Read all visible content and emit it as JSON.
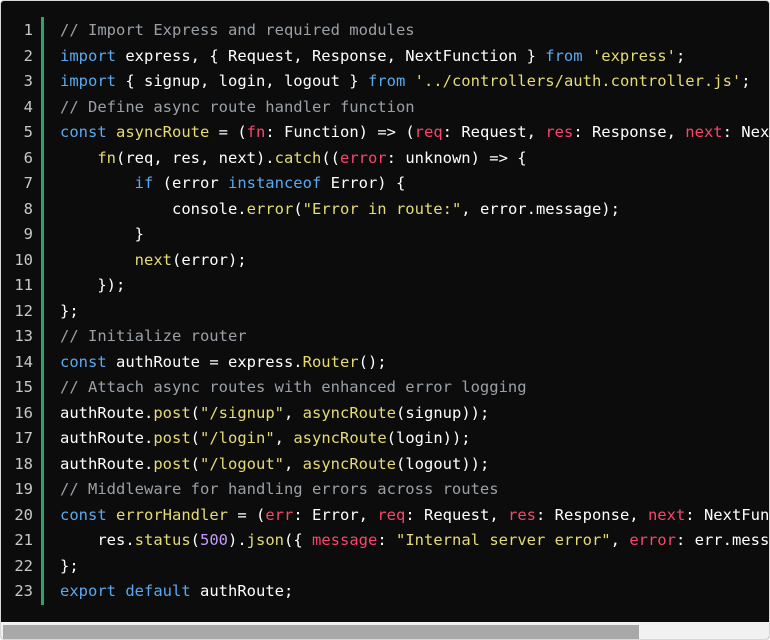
{
  "editor": {
    "accent_color": "#2fa36a",
    "background_color": "#0c0c0c",
    "lines": [
      {
        "n": "1",
        "tokens": [
          {
            "t": "comment",
            "v": "// Import Express and required modules"
          }
        ]
      },
      {
        "n": "2",
        "tokens": [
          {
            "t": "kw",
            "v": "import"
          },
          {
            "t": "plain",
            "v": " express, { Request, Response, NextFunction } "
          },
          {
            "t": "kw",
            "v": "from"
          },
          {
            "t": "plain",
            "v": " "
          },
          {
            "t": "str",
            "v": "'express'"
          },
          {
            "t": "plain",
            "v": ";"
          }
        ]
      },
      {
        "n": "3",
        "tokens": [
          {
            "t": "kw",
            "v": "import"
          },
          {
            "t": "plain",
            "v": " { signup, login, logout } "
          },
          {
            "t": "kw",
            "v": "from"
          },
          {
            "t": "plain",
            "v": " "
          },
          {
            "t": "str",
            "v": "'../controllers/auth.controller.js'"
          },
          {
            "t": "plain",
            "v": ";"
          }
        ]
      },
      {
        "n": "4",
        "tokens": [
          {
            "t": "comment",
            "v": "// Define async route handler function"
          }
        ]
      },
      {
        "n": "5",
        "tokens": [
          {
            "t": "kw",
            "v": "const"
          },
          {
            "t": "plain",
            "v": " "
          },
          {
            "t": "fn",
            "v": "asyncRoute"
          },
          {
            "t": "plain",
            "v": " = ("
          },
          {
            "t": "param",
            "v": "fn"
          },
          {
            "t": "plain",
            "v": ": Function) => ("
          },
          {
            "t": "param",
            "v": "req"
          },
          {
            "t": "plain",
            "v": ": Request, "
          },
          {
            "t": "param",
            "v": "res"
          },
          {
            "t": "plain",
            "v": ": Response, "
          },
          {
            "t": "param",
            "v": "next"
          },
          {
            "t": "plain",
            "v": ": NextFunction) => {"
          }
        ]
      },
      {
        "n": "6",
        "tokens": [
          {
            "t": "plain",
            "v": "    "
          },
          {
            "t": "fn",
            "v": "fn"
          },
          {
            "t": "plain",
            "v": "(req, res, next)."
          },
          {
            "t": "fn",
            "v": "catch"
          },
          {
            "t": "plain",
            "v": "(("
          },
          {
            "t": "param",
            "v": "error"
          },
          {
            "t": "plain",
            "v": ": unknown) => {"
          }
        ]
      },
      {
        "n": "7",
        "tokens": [
          {
            "t": "plain",
            "v": "        "
          },
          {
            "t": "kw",
            "v": "if"
          },
          {
            "t": "plain",
            "v": " (error "
          },
          {
            "t": "kw",
            "v": "instanceof"
          },
          {
            "t": "plain",
            "v": " Error) {"
          }
        ]
      },
      {
        "n": "8",
        "tokens": [
          {
            "t": "plain",
            "v": "            console."
          },
          {
            "t": "fn",
            "v": "error"
          },
          {
            "t": "plain",
            "v": "("
          },
          {
            "t": "str",
            "v": "\"Error in route:\""
          },
          {
            "t": "plain",
            "v": ", error.message);"
          }
        ]
      },
      {
        "n": "9",
        "tokens": [
          {
            "t": "plain",
            "v": "        }"
          }
        ]
      },
      {
        "n": "10",
        "tokens": [
          {
            "t": "plain",
            "v": "        "
          },
          {
            "t": "fn",
            "v": "next"
          },
          {
            "t": "plain",
            "v": "(error);"
          }
        ]
      },
      {
        "n": "11",
        "tokens": [
          {
            "t": "plain",
            "v": "    });"
          }
        ]
      },
      {
        "n": "12",
        "tokens": [
          {
            "t": "plain",
            "v": "};"
          }
        ]
      },
      {
        "n": "13",
        "tokens": [
          {
            "t": "comment",
            "v": "// Initialize router"
          }
        ]
      },
      {
        "n": "14",
        "tokens": [
          {
            "t": "kw",
            "v": "const"
          },
          {
            "t": "plain",
            "v": " authRoute = express."
          },
          {
            "t": "fn",
            "v": "Router"
          },
          {
            "t": "plain",
            "v": "();"
          }
        ]
      },
      {
        "n": "15",
        "tokens": [
          {
            "t": "comment",
            "v": "// Attach async routes with enhanced error logging"
          }
        ]
      },
      {
        "n": "16",
        "tokens": [
          {
            "t": "plain",
            "v": "authRoute."
          },
          {
            "t": "fn",
            "v": "post"
          },
          {
            "t": "plain",
            "v": "("
          },
          {
            "t": "str",
            "v": "\"/signup\""
          },
          {
            "t": "plain",
            "v": ", "
          },
          {
            "t": "fn",
            "v": "asyncRoute"
          },
          {
            "t": "plain",
            "v": "(signup));"
          }
        ]
      },
      {
        "n": "17",
        "tokens": [
          {
            "t": "plain",
            "v": "authRoute."
          },
          {
            "t": "fn",
            "v": "post"
          },
          {
            "t": "plain",
            "v": "("
          },
          {
            "t": "str",
            "v": "\"/login\""
          },
          {
            "t": "plain",
            "v": ", "
          },
          {
            "t": "fn",
            "v": "asyncRoute"
          },
          {
            "t": "plain",
            "v": "(login));"
          }
        ]
      },
      {
        "n": "18",
        "tokens": [
          {
            "t": "plain",
            "v": "authRoute."
          },
          {
            "t": "fn",
            "v": "post"
          },
          {
            "t": "plain",
            "v": "("
          },
          {
            "t": "str",
            "v": "\"/logout\""
          },
          {
            "t": "plain",
            "v": ", "
          },
          {
            "t": "fn",
            "v": "asyncRoute"
          },
          {
            "t": "plain",
            "v": "(logout));"
          }
        ]
      },
      {
        "n": "19",
        "tokens": [
          {
            "t": "comment",
            "v": "// Middleware for handling errors across routes"
          }
        ]
      },
      {
        "n": "20",
        "tokens": [
          {
            "t": "kw",
            "v": "const"
          },
          {
            "t": "plain",
            "v": " "
          },
          {
            "t": "fn",
            "v": "errorHandler"
          },
          {
            "t": "plain",
            "v": " = ("
          },
          {
            "t": "param",
            "v": "err"
          },
          {
            "t": "plain",
            "v": ": Error, "
          },
          {
            "t": "param",
            "v": "req"
          },
          {
            "t": "plain",
            "v": ": Request, "
          },
          {
            "t": "param",
            "v": "res"
          },
          {
            "t": "plain",
            "v": ": Response, "
          },
          {
            "t": "param",
            "v": "next"
          },
          {
            "t": "plain",
            "v": ": NextFunction) => {"
          }
        ]
      },
      {
        "n": "21",
        "tokens": [
          {
            "t": "plain",
            "v": "    res."
          },
          {
            "t": "fn",
            "v": "status"
          },
          {
            "t": "plain",
            "v": "("
          },
          {
            "t": "num",
            "v": "500"
          },
          {
            "t": "plain",
            "v": ")."
          },
          {
            "t": "fn",
            "v": "json"
          },
          {
            "t": "plain",
            "v": "({ "
          },
          {
            "t": "param",
            "v": "message"
          },
          {
            "t": "plain",
            "v": ": "
          },
          {
            "t": "str",
            "v": "\"Internal server error\""
          },
          {
            "t": "plain",
            "v": ", "
          },
          {
            "t": "param",
            "v": "error"
          },
          {
            "t": "plain",
            "v": ": err.message });"
          }
        ]
      },
      {
        "n": "22",
        "tokens": [
          {
            "t": "plain",
            "v": "};"
          }
        ]
      },
      {
        "n": "23",
        "tokens": [
          {
            "t": "kw",
            "v": "export"
          },
          {
            "t": "plain",
            "v": " "
          },
          {
            "t": "kw",
            "v": "default"
          },
          {
            "t": "plain",
            "v": " authRoute;"
          }
        ]
      }
    ]
  },
  "scrollbar": {
    "horizontal_position": 0
  }
}
